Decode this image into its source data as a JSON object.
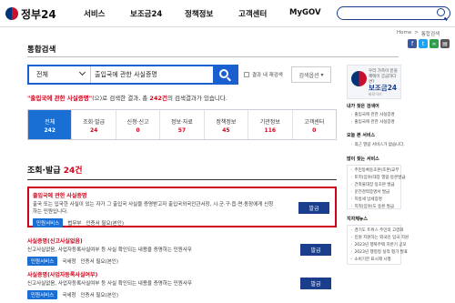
{
  "header": {
    "logo_text": "정부24",
    "nav": [
      "서비스",
      "보조금24",
      "정책정보",
      "고객센터",
      "MyGOV"
    ],
    "search_placeholder": ""
  },
  "breadcrumb": [
    "Home",
    ">",
    "통합검색"
  ],
  "page_title": "통합검색",
  "search": {
    "scope": "전체",
    "query": "출입국에 관한 사실증명",
    "within_results_label": "결과 내 재검색",
    "options_label": "검색옵션"
  },
  "summary": {
    "keyword": "\"출입국에 관한 사실증명\"",
    "middle": "(으)로 검색한 결과, 총",
    "total": "242건",
    "end": "의 검색결과가 있습니다."
  },
  "tabs": [
    {
      "label": "전체",
      "count": "242",
      "active": true
    },
    {
      "label": "조회·발급",
      "count": "24"
    },
    {
      "label": "신청·신고",
      "count": "0"
    },
    {
      "label": "정보·자료",
      "count": "57"
    },
    {
      "label": "정책정보",
      "count": "45"
    },
    {
      "label": "기관정보",
      "count": "116"
    },
    {
      "label": "고객센터",
      "count": "0"
    }
  ],
  "section": {
    "title": "조회·발급",
    "count": "24건"
  },
  "items": [
    {
      "title": "출입국에 관한 사실증명",
      "desc": "출국 또는 입국한 사실이 있는 자가 그 출입국 사실을 증명받고자 출입국외국인관서장, 시·군·구·읍·면·동장에게 신청하는 민원입니다.",
      "badge": "민원서비스",
      "agency": "법무부",
      "auth": "인증서 필요(본인)",
      "apply": "발급"
    },
    {
      "title": "사실증명(신고사실없음)",
      "desc": "신고사실없음, 사업자등록사실여부 등 사실 확인되는 내용을 증명하는 민원사무",
      "badge": "민원서비스",
      "agency": "국세청",
      "auth": "인증서 필요(본인)",
      "apply": "발급"
    },
    {
      "title": "사실증명(사업자등록사실여부)",
      "desc": "신고사실없음, 사업자등록사실여부 등 사실 확인되는 내용을 증명하는 민원사무",
      "badge": "민원서비스",
      "agency": "국세청",
      "auth": "인증서 필요(본인)",
      "apply": "발급"
    }
  ],
  "sidebar": {
    "promo_line1": "우리 가족이 받을",
    "promo_line2": "혜택이 궁금하다면?",
    "promo_title": "보조금24",
    "promo_sub": "바로가기",
    "my_search_title": "내가 찾은 검색어",
    "my_searches": [
      "출입국에 관한 사실증명",
      "출입국에 관한 사실증명"
    ],
    "today_title": "오늘 본 서비스",
    "today_items": [
      "최근 열람 서비스가 없습니다."
    ],
    "popular_title": "많이 찾는 서비스",
    "popular_items": [
      "주민등록등초본(조본)교부",
      "토지(임야)대장 열람·등본발급",
      "건축물대장 등초본 발급",
      "운전경력증명서 발급",
      "지방세 납세증명",
      "지적(임야)도 등본 발급"
    ],
    "related_title": "지자체뉴스",
    "related_items": [
      "경기도 트위스 주민의 고령화",
      "민원 지원하는 외국인 입국 지원",
      "2023년 행복주택 하반기 공모",
      "2023년 행정청 실적 평가 발표",
      "소비기한 표시제 시행"
    ]
  },
  "colors": {
    "accent": "#1a6fd4",
    "navy": "#1a3e8c",
    "highlight": "#d0021b"
  }
}
